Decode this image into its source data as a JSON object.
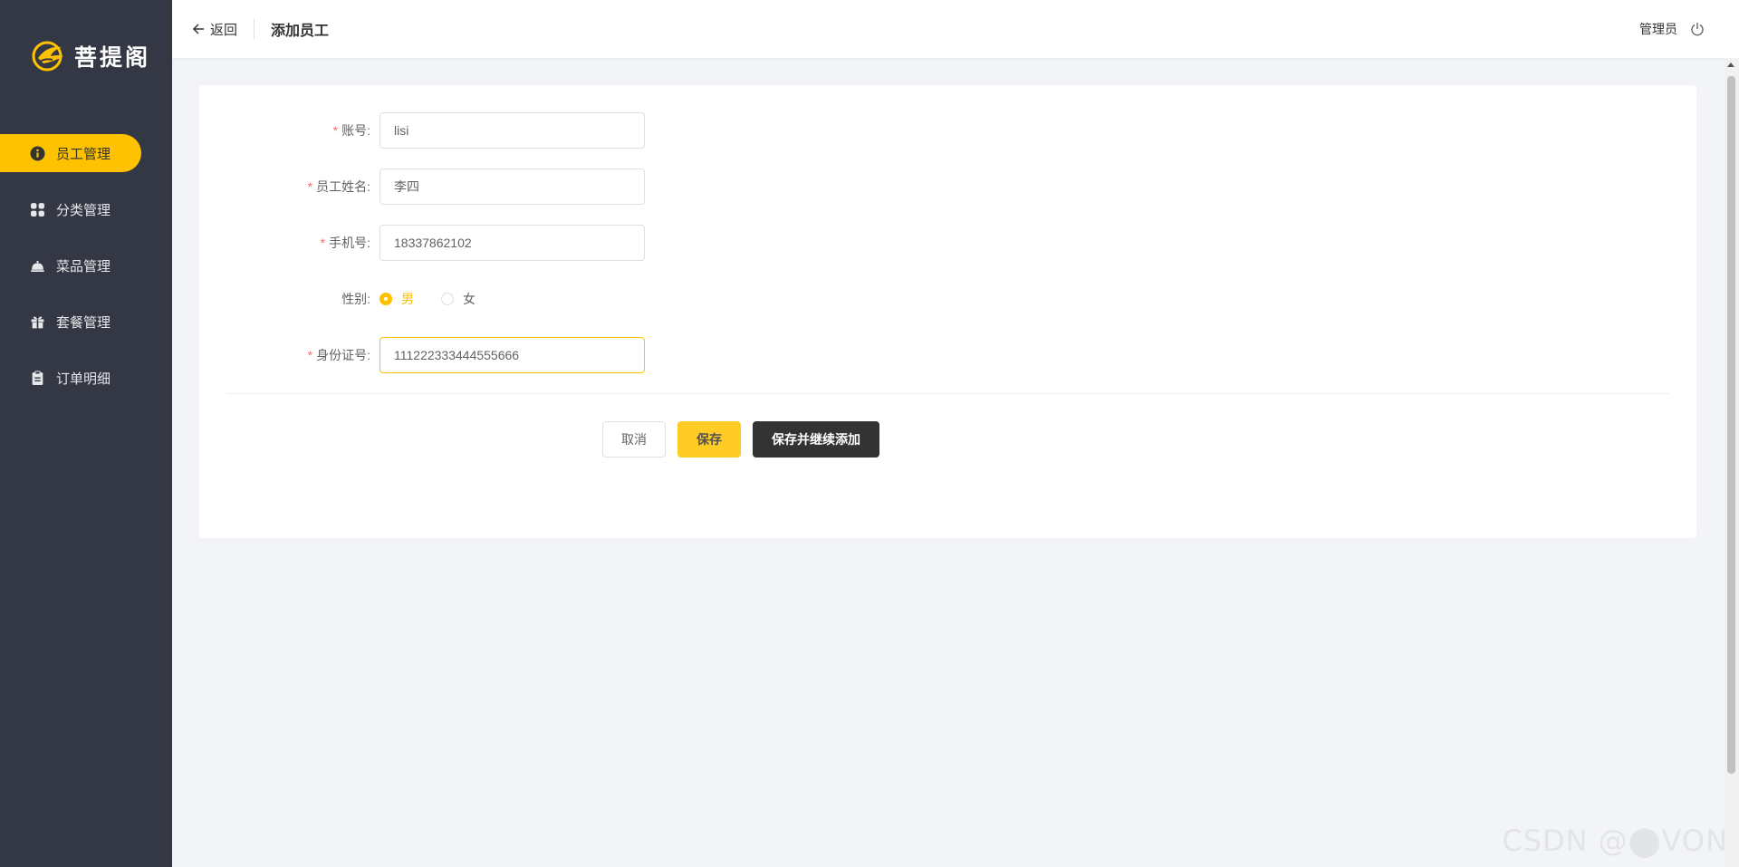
{
  "brand": {
    "name": "菩提阁",
    "accent": "#ffc200",
    "sidebar_bg": "#343744"
  },
  "sidebar": {
    "items": [
      {
        "label": "员工管理",
        "icon": "info-circle-icon",
        "active": true
      },
      {
        "label": "分类管理",
        "icon": "grid-icon",
        "active": false
      },
      {
        "label": "菜品管理",
        "icon": "cloche-icon",
        "active": false
      },
      {
        "label": "套餐管理",
        "icon": "gift-icon",
        "active": false
      },
      {
        "label": "订单明细",
        "icon": "clipboard-icon",
        "active": false
      }
    ]
  },
  "header": {
    "back_label": "返回",
    "title": "添加员工",
    "user": "管理员",
    "logout_icon": "power-icon"
  },
  "form": {
    "account": {
      "label": "账号:",
      "value": "lisi"
    },
    "name": {
      "label": "员工姓名:",
      "value": "李四"
    },
    "phone": {
      "label": "手机号:",
      "value": "18337862102"
    },
    "gender": {
      "label": "性别:",
      "options": [
        "男",
        "女"
      ],
      "selected": "男"
    },
    "id_number": {
      "label": "身份证号:",
      "value": "111222333444555666"
    }
  },
  "actions": {
    "cancel": "取消",
    "save": "保存",
    "save_continue": "保存并继续添加"
  },
  "watermark": "CSDN @⬤VON"
}
